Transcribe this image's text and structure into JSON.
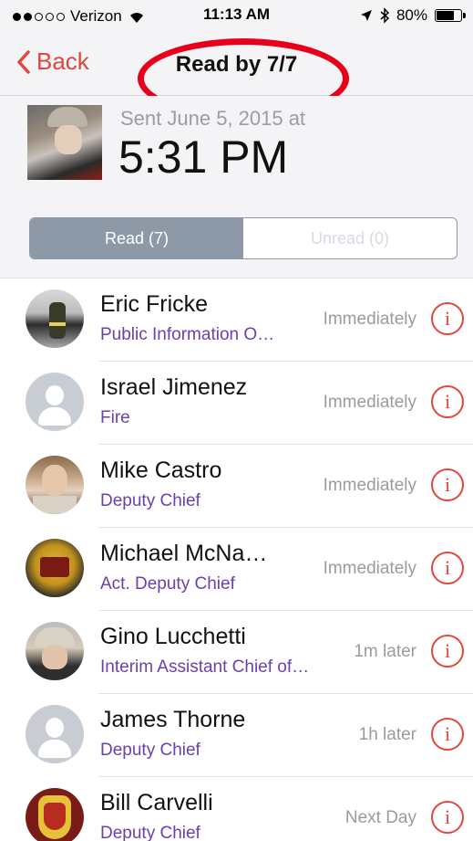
{
  "status_bar": {
    "carrier": "Verizon",
    "time": "11:13 AM",
    "battery": "80%",
    "battery_level": 0.8,
    "signal_bars_filled": 2,
    "signal_bars_total": 5
  },
  "nav": {
    "back_label": "Back",
    "title": "Read by 7/7",
    "accent_color": "#e0473b",
    "annotation_color": "#e8001a"
  },
  "header": {
    "sent_label": "Sent June 5, 2015 at",
    "sent_time": "5:31 PM"
  },
  "segments": {
    "read_label": "Read (7)",
    "unread_label": "Unread (0)",
    "selected": "read"
  },
  "recipients": [
    {
      "name": "Eric Fricke",
      "role": "Public Information O…",
      "when": "Immediately",
      "avatar": "photo"
    },
    {
      "name": "Israel Jimenez",
      "role": "Fire",
      "when": "Immediately",
      "avatar": "placeholder-person-icon"
    },
    {
      "name": "Mike Castro",
      "role": "Deputy Chief",
      "when": "Immediately",
      "avatar": "photo"
    },
    {
      "name": "Michael McNa…",
      "role": "Act. Deputy Chief",
      "when": "Immediately",
      "avatar": "photo"
    },
    {
      "name": "Gino Lucchetti",
      "role": "Interim Assistant Chief of…",
      "when": "1m later",
      "avatar": "photo"
    },
    {
      "name": "James Thorne",
      "role": "Deputy Chief",
      "when": "1h later",
      "avatar": "placeholder-person-icon"
    },
    {
      "name": "Bill Carvelli",
      "role": "Deputy Chief",
      "when": "Next Day",
      "avatar": "photo"
    }
  ],
  "colors": {
    "role_text": "#6a3fb0",
    "info_icon": "#e2463c",
    "segment_active": "#8e99a8"
  }
}
